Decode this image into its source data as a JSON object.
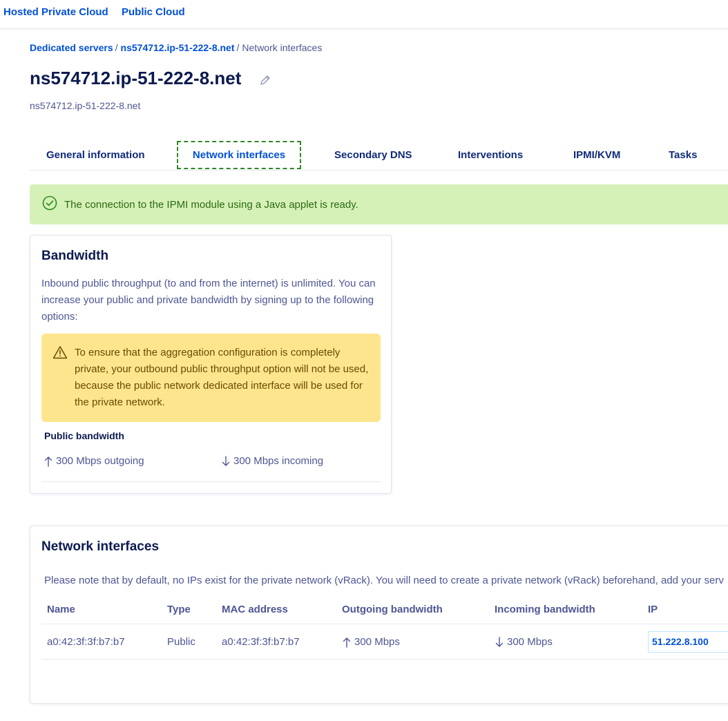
{
  "topnav": {
    "items": [
      {
        "label": "Hosted Private Cloud"
      },
      {
        "label": "Public Cloud"
      }
    ]
  },
  "breadcrumb": {
    "items": [
      {
        "label": "Dedicated servers"
      },
      {
        "label": "ns574712.ip-51-222-8.net"
      },
      {
        "label": "Network interfaces"
      }
    ],
    "separator": "/"
  },
  "header": {
    "title": "ns574712.ip-51-222-8.net",
    "subtitle": "ns574712.ip-51-222-8.net"
  },
  "tabs": [
    {
      "label": "General information"
    },
    {
      "label": "Network interfaces",
      "active": true
    },
    {
      "label": "Secondary DNS"
    },
    {
      "label": "Interventions"
    },
    {
      "label": "IPMI/KVM"
    },
    {
      "label": "Tasks"
    }
  ],
  "alert": {
    "icon": "check-circle-icon",
    "text": "The connection to the IPMI module using a Java applet is ready."
  },
  "bandwidth": {
    "title": "Bandwidth",
    "description": "Inbound public throughput (to and from the internet) is unlimited. You can increase your public and private bandwidth by signing up to the following options:",
    "warning": {
      "icon": "warning-triangle-icon",
      "text": "To ensure that the aggregation configuration is completely private, your outbound public throughput option will not be used, because the public network dedicated interface will be used for the private network."
    },
    "public_bandwidth_title": "Public bandwidth",
    "outgoing": "300 Mbps outgoing",
    "incoming": "300 Mbps incoming"
  },
  "network": {
    "title": "Network interfaces",
    "note": "Please note that by default, no IPs exist for the private network (vRack). You will need to create a private network (vRack) beforehand, add your serv",
    "columns": [
      "Name",
      "Type",
      "MAC address",
      "Outgoing bandwidth",
      "Incoming bandwidth",
      "IP"
    ],
    "rows": [
      {
        "name": "a0:42:3f:3f:b7:b7",
        "type": "Public",
        "mac": "a0:42:3f:3f:b7:b7",
        "outgoing": "300 Mbps",
        "incoming": "300 Mbps",
        "ip": "51.222.8.100"
      }
    ]
  },
  "colors": {
    "link": "#0050d7",
    "title": "#0b1a4f",
    "text": "#4d5693",
    "success_bg": "#d6f1b8",
    "success_text": "#2b6a12",
    "warning_bg": "#fde58e",
    "active_tab_border": "#2b8a1f"
  }
}
